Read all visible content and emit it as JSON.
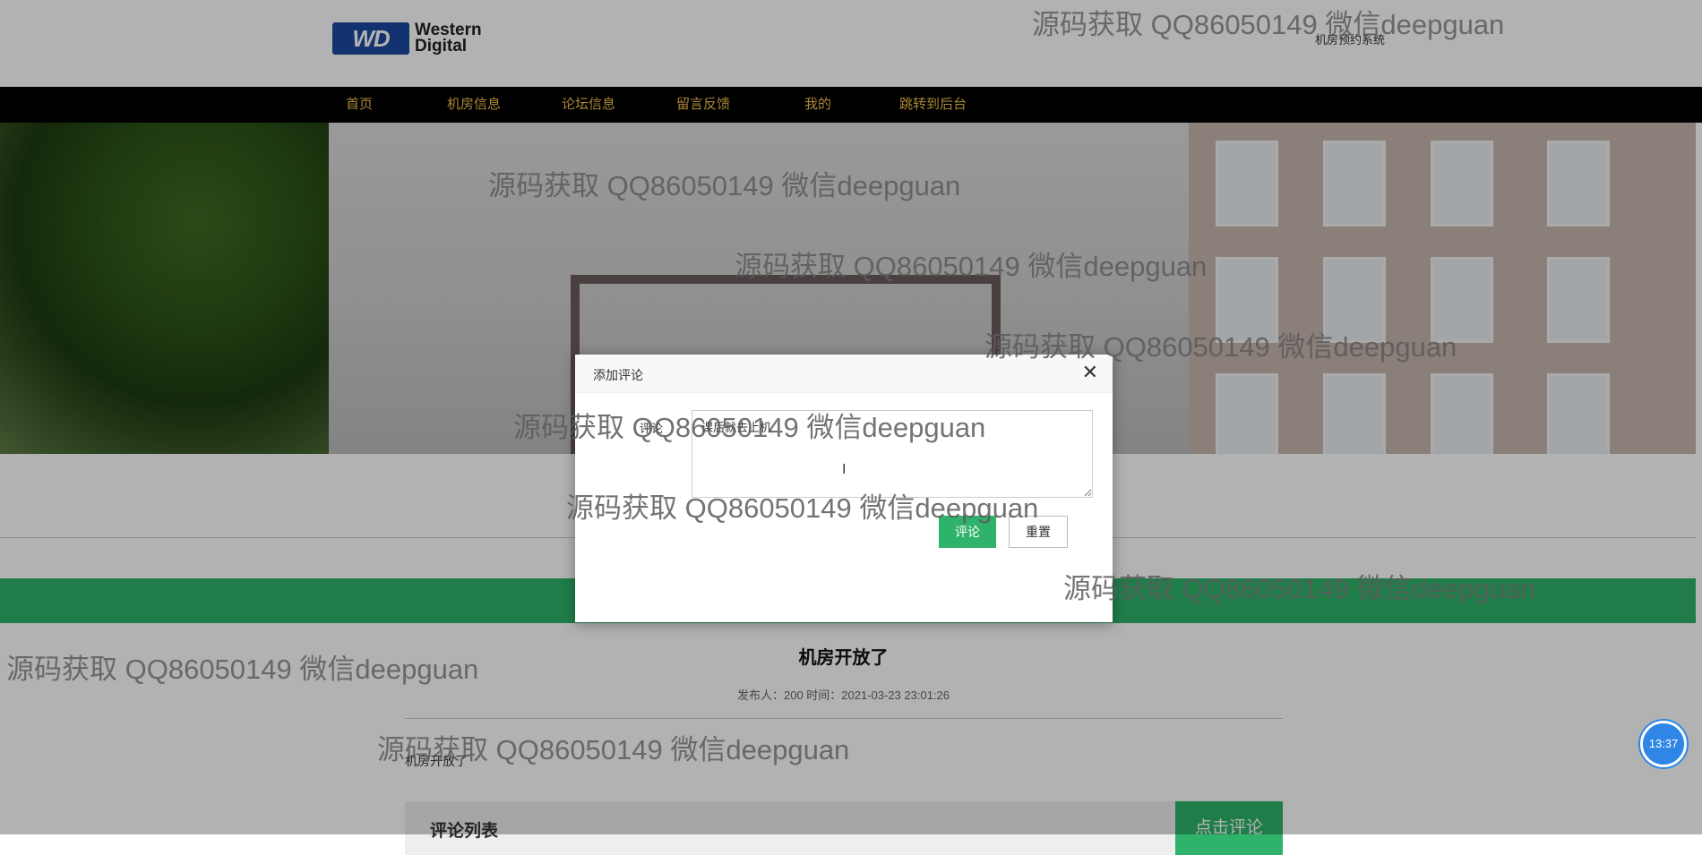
{
  "header": {
    "logo_badge": "WD",
    "logo_text_line1": "Western",
    "logo_text_line2": "Digital",
    "system_name": "机房预约系统"
  },
  "nav": {
    "items": [
      "首页",
      "机房信息",
      "论坛信息",
      "留言反馈",
      "我的",
      "跳转到后台"
    ]
  },
  "article": {
    "title": "机房开放了",
    "meta": "发布人：200 时间：2021-03-23 23:01:26",
    "body": "机房开放了"
  },
  "comment_bar": {
    "title": "评论列表",
    "button": "点击评论"
  },
  "modal": {
    "title": "添加评论",
    "close_icon": "close-icon",
    "field_label": "评论",
    "field_value": "课后就去上机",
    "submit_label": "评论",
    "reset_label": "重置"
  },
  "watermark": {
    "text": "源码获取 QQ86050149 微信deepguan"
  },
  "clock": {
    "time": "13:37"
  },
  "colors": {
    "nav_bg": "#000000",
    "nav_text": "#f2c14e",
    "accent_green": "#2fb36a",
    "clock_blue": "#2f86e6"
  }
}
